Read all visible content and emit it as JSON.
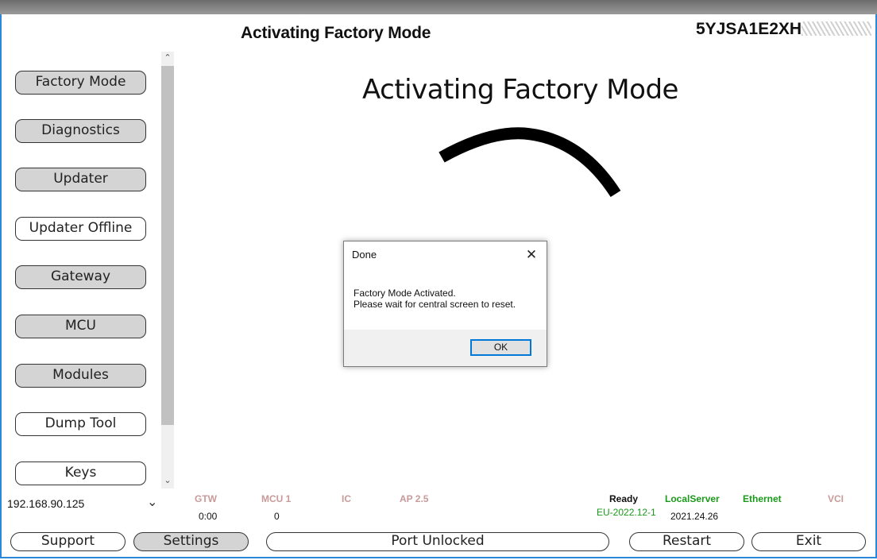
{
  "header": {
    "title": "Activating Factory Mode",
    "vin": "5YJSA1E2XH"
  },
  "sidebar": {
    "items": [
      {
        "label": "Factory Mode"
      },
      {
        "label": "Diagnostics"
      },
      {
        "label": "Updater"
      },
      {
        "label": "Updater Offline"
      },
      {
        "label": "Gateway"
      },
      {
        "label": "MCU"
      },
      {
        "label": "Modules"
      },
      {
        "label": "Dump Tool"
      },
      {
        "label": "Keys"
      }
    ],
    "ip": "192.168.90.125"
  },
  "main": {
    "heading": "Activating Factory Mode"
  },
  "dialog": {
    "title": "Done",
    "line1": "Factory Mode Activated.",
    "line2": "Please wait for central screen to reset.",
    "ok_label": "OK"
  },
  "status": {
    "gtw_label": "GTW",
    "gtw_value": "0:00",
    "mcu_label": "MCU 1",
    "mcu_value": "0",
    "ic_label": "IC",
    "ap_label": "AP 2.5",
    "ready_label": "Ready",
    "ready_value": "EU-2022.12-1",
    "localserver_label": "LocalServer",
    "localserver_value": "2021.24.26",
    "ethernet_label": "Ethernet",
    "vci_label": "VCI"
  },
  "footer": {
    "support_label": "Support",
    "settings_label": "Settings",
    "port_label": "Port Unlocked",
    "restart_label": "Restart",
    "exit_label": "Exit"
  },
  "colors": {
    "accent": "#2b88d8",
    "ok_border": "#0078d7",
    "green_status": "#1a9a1a",
    "faded_status": "#c89a9a",
    "button_gray": "#d4d4d4"
  }
}
